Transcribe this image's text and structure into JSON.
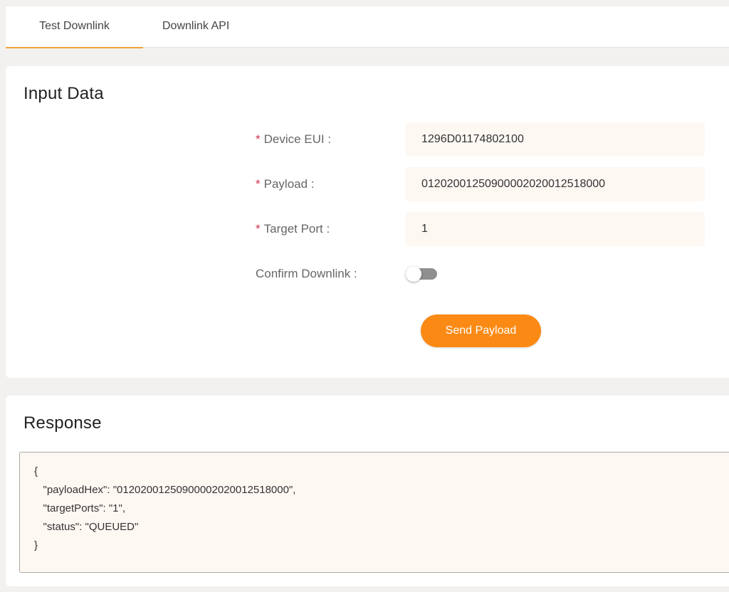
{
  "tabs": [
    {
      "label": "Test Downlink",
      "active": true
    },
    {
      "label": "Downlink API",
      "active": false
    }
  ],
  "input_card": {
    "title": "Input Data",
    "fields": [
      {
        "label": "Device EUI :",
        "required": true,
        "value": "1296D01174802100"
      },
      {
        "label": "Payload :",
        "required": true,
        "value": "01202001250900002020012518000"
      },
      {
        "label": "Target Port :",
        "required": true,
        "value": "1"
      }
    ],
    "confirm": {
      "label": "Confirm Downlink :",
      "enabled": false
    },
    "required_marker": "*",
    "send_label": "Send Payload"
  },
  "response_card": {
    "title": "Response",
    "body": "{\n   \"payloadHex\": \"01202001250900002020012518000\",\n   \"targetPorts\": \"1\",\n   \"status\": \"QUEUED\"\n}"
  },
  "colors": {
    "accent": "#fb8a14",
    "tab_underline": "#f0a43a",
    "required": "#d0314b",
    "input_bg": "#fef8f3"
  }
}
